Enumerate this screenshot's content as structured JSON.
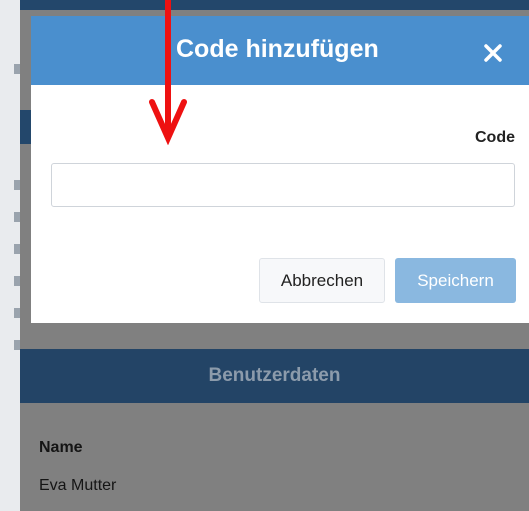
{
  "modal": {
    "title": "Code hinzufügen",
    "close_icon": "close-icon",
    "code_label": "Code",
    "code_value": "",
    "code_placeholder": "",
    "cancel_label": "Abbrechen",
    "save_label": "Speichern"
  },
  "background": {
    "section_title": "Benutzerdaten",
    "name_label": "Name",
    "name_value": "Eva Mutter"
  },
  "annotation": {
    "icon": "red-down-arrow-icon",
    "color": "#ee1111"
  },
  "colors": {
    "header": "#4a8fce",
    "save_button": "#8ab8e0",
    "section_header": "#234466"
  }
}
